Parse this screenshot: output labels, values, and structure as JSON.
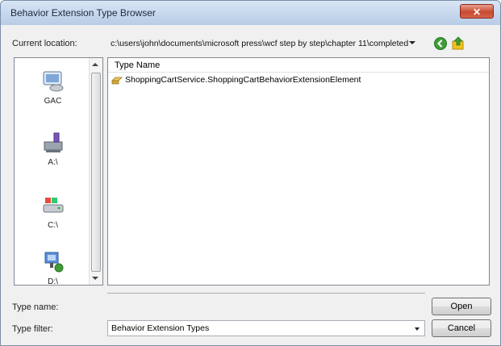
{
  "window": {
    "title": "Behavior Extension Type Browser",
    "close_glyph": "✕"
  },
  "location": {
    "label": "Current location:",
    "path": "c:\\users\\john\\documents\\microsoft press\\wcf step by step\\chapter 11\\completed",
    "back_icon": "back-icon",
    "up_icon": "up-folder-icon"
  },
  "locations": [
    {
      "label": "GAC",
      "icon": "gac-icon"
    },
    {
      "label": "A:\\",
      "icon": "floppy-drive-icon"
    },
    {
      "label": "C:\\",
      "icon": "hard-drive-icon"
    },
    {
      "label": "D:\\",
      "icon": "network-drive-icon"
    }
  ],
  "types": {
    "column_header": "Type Name",
    "items": [
      {
        "name": "ShoppingCartService.ShoppingCartBehaviorExtensionElement",
        "icon": "type-icon"
      }
    ]
  },
  "type_name": {
    "label": "Type name:",
    "value": ""
  },
  "type_filter": {
    "label": "Type filter:",
    "value": "Behavior Extension Types"
  },
  "buttons": {
    "open": "Open",
    "cancel": "Cancel"
  },
  "colors": {
    "accent_green": "#3f9c35",
    "close_red": "#c74a30",
    "title_bar": "#c9d8ec"
  }
}
